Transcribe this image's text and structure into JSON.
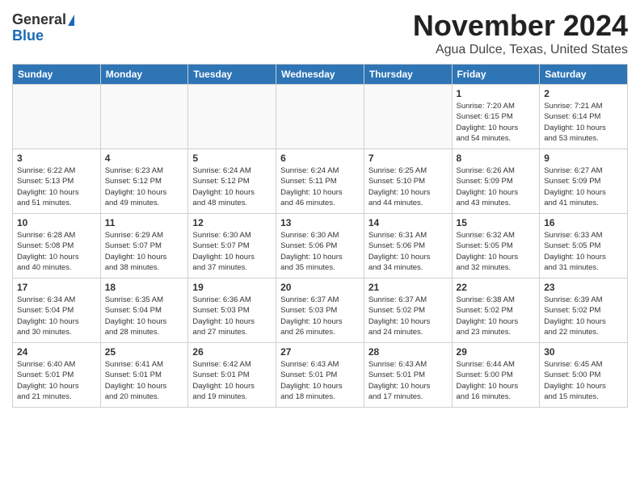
{
  "header": {
    "logo_general": "General",
    "logo_blue": "Blue",
    "month": "November 2024",
    "location": "Agua Dulce, Texas, United States"
  },
  "weekdays": [
    "Sunday",
    "Monday",
    "Tuesday",
    "Wednesday",
    "Thursday",
    "Friday",
    "Saturday"
  ],
  "weeks": [
    [
      {
        "day": "",
        "content": ""
      },
      {
        "day": "",
        "content": ""
      },
      {
        "day": "",
        "content": ""
      },
      {
        "day": "",
        "content": ""
      },
      {
        "day": "",
        "content": ""
      },
      {
        "day": "1",
        "content": "Sunrise: 7:20 AM\nSunset: 6:15 PM\nDaylight: 10 hours\nand 54 minutes."
      },
      {
        "day": "2",
        "content": "Sunrise: 7:21 AM\nSunset: 6:14 PM\nDaylight: 10 hours\nand 53 minutes."
      }
    ],
    [
      {
        "day": "3",
        "content": "Sunrise: 6:22 AM\nSunset: 5:13 PM\nDaylight: 10 hours\nand 51 minutes."
      },
      {
        "day": "4",
        "content": "Sunrise: 6:23 AM\nSunset: 5:12 PM\nDaylight: 10 hours\nand 49 minutes."
      },
      {
        "day": "5",
        "content": "Sunrise: 6:24 AM\nSunset: 5:12 PM\nDaylight: 10 hours\nand 48 minutes."
      },
      {
        "day": "6",
        "content": "Sunrise: 6:24 AM\nSunset: 5:11 PM\nDaylight: 10 hours\nand 46 minutes."
      },
      {
        "day": "7",
        "content": "Sunrise: 6:25 AM\nSunset: 5:10 PM\nDaylight: 10 hours\nand 44 minutes."
      },
      {
        "day": "8",
        "content": "Sunrise: 6:26 AM\nSunset: 5:09 PM\nDaylight: 10 hours\nand 43 minutes."
      },
      {
        "day": "9",
        "content": "Sunrise: 6:27 AM\nSunset: 5:09 PM\nDaylight: 10 hours\nand 41 minutes."
      }
    ],
    [
      {
        "day": "10",
        "content": "Sunrise: 6:28 AM\nSunset: 5:08 PM\nDaylight: 10 hours\nand 40 minutes."
      },
      {
        "day": "11",
        "content": "Sunrise: 6:29 AM\nSunset: 5:07 PM\nDaylight: 10 hours\nand 38 minutes."
      },
      {
        "day": "12",
        "content": "Sunrise: 6:30 AM\nSunset: 5:07 PM\nDaylight: 10 hours\nand 37 minutes."
      },
      {
        "day": "13",
        "content": "Sunrise: 6:30 AM\nSunset: 5:06 PM\nDaylight: 10 hours\nand 35 minutes."
      },
      {
        "day": "14",
        "content": "Sunrise: 6:31 AM\nSunset: 5:06 PM\nDaylight: 10 hours\nand 34 minutes."
      },
      {
        "day": "15",
        "content": "Sunrise: 6:32 AM\nSunset: 5:05 PM\nDaylight: 10 hours\nand 32 minutes."
      },
      {
        "day": "16",
        "content": "Sunrise: 6:33 AM\nSunset: 5:05 PM\nDaylight: 10 hours\nand 31 minutes."
      }
    ],
    [
      {
        "day": "17",
        "content": "Sunrise: 6:34 AM\nSunset: 5:04 PM\nDaylight: 10 hours\nand 30 minutes."
      },
      {
        "day": "18",
        "content": "Sunrise: 6:35 AM\nSunset: 5:04 PM\nDaylight: 10 hours\nand 28 minutes."
      },
      {
        "day": "19",
        "content": "Sunrise: 6:36 AM\nSunset: 5:03 PM\nDaylight: 10 hours\nand 27 minutes."
      },
      {
        "day": "20",
        "content": "Sunrise: 6:37 AM\nSunset: 5:03 PM\nDaylight: 10 hours\nand 26 minutes."
      },
      {
        "day": "21",
        "content": "Sunrise: 6:37 AM\nSunset: 5:02 PM\nDaylight: 10 hours\nand 24 minutes."
      },
      {
        "day": "22",
        "content": "Sunrise: 6:38 AM\nSunset: 5:02 PM\nDaylight: 10 hours\nand 23 minutes."
      },
      {
        "day": "23",
        "content": "Sunrise: 6:39 AM\nSunset: 5:02 PM\nDaylight: 10 hours\nand 22 minutes."
      }
    ],
    [
      {
        "day": "24",
        "content": "Sunrise: 6:40 AM\nSunset: 5:01 PM\nDaylight: 10 hours\nand 21 minutes."
      },
      {
        "day": "25",
        "content": "Sunrise: 6:41 AM\nSunset: 5:01 PM\nDaylight: 10 hours\nand 20 minutes."
      },
      {
        "day": "26",
        "content": "Sunrise: 6:42 AM\nSunset: 5:01 PM\nDaylight: 10 hours\nand 19 minutes."
      },
      {
        "day": "27",
        "content": "Sunrise: 6:43 AM\nSunset: 5:01 PM\nDaylight: 10 hours\nand 18 minutes."
      },
      {
        "day": "28",
        "content": "Sunrise: 6:43 AM\nSunset: 5:01 PM\nDaylight: 10 hours\nand 17 minutes."
      },
      {
        "day": "29",
        "content": "Sunrise: 6:44 AM\nSunset: 5:00 PM\nDaylight: 10 hours\nand 16 minutes."
      },
      {
        "day": "30",
        "content": "Sunrise: 6:45 AM\nSunset: 5:00 PM\nDaylight: 10 hours\nand 15 minutes."
      }
    ]
  ]
}
